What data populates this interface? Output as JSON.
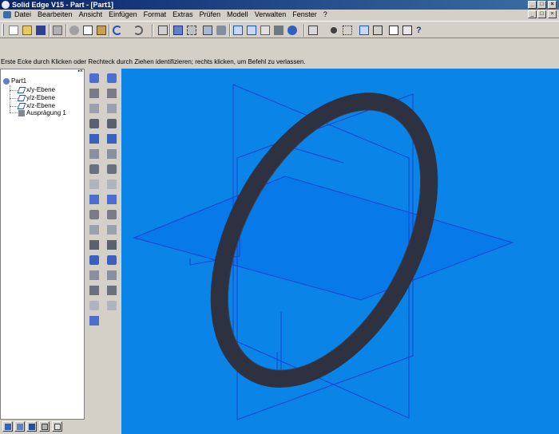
{
  "window": {
    "title": "Solid Edge V15 - Part - [Part1]"
  },
  "window_buttons": {
    "minimize": "_",
    "maximize": "□",
    "close": "×"
  },
  "menu": {
    "items": [
      "Datei",
      "Bearbeiten",
      "Ansicht",
      "Einfügen",
      "Format",
      "Extras",
      "Prüfen",
      "Modell",
      "Verwalten",
      "Fenster",
      "?"
    ]
  },
  "prompt": {
    "text": "Erste Ecke durch Klicken oder  Rechteck durch Ziehen identifizieren; rechts klicken, um Befehl zu verlassen."
  },
  "tree": {
    "root": "Part1",
    "items": [
      "x/y-Ebene",
      "y/z-Ebene",
      "x/z-Ebene",
      "Ausprägung 1"
    ]
  },
  "colors": {
    "viewport_bg": "#0a84e6",
    "plane_line": "#1a3fd1",
    "ring": "#2e3240",
    "titlebar": "#0a246a"
  },
  "icons": {
    "toolbar": [
      "new-icon",
      "open-icon",
      "save-icon",
      "print-icon",
      "cut-icon",
      "copy-icon",
      "paste-icon",
      "undo-icon",
      "redo-icon",
      "select-icon",
      "zoom-area-icon",
      "fit-icon",
      "pan-icon",
      "rotate-icon",
      "view-iso-icon",
      "shade-icon",
      "render-icon",
      "help-icon"
    ]
  }
}
